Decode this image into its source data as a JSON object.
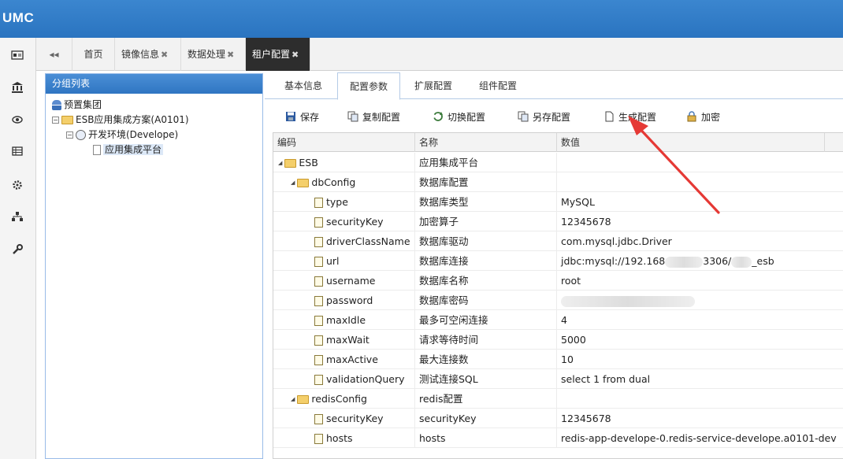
{
  "app": {
    "title": "UMC"
  },
  "sidebar_icons": [
    "id-card-icon",
    "bank-icon",
    "eye-icon",
    "list-icon",
    "gear-icon",
    "sitemap-icon",
    "wrench-icon"
  ],
  "tabs": {
    "nav_glyph": "◂◂",
    "items": [
      {
        "label": "首页",
        "closable": false
      },
      {
        "label": "镜像信息",
        "closable": true
      },
      {
        "label": "数据处理",
        "closable": true
      },
      {
        "label": "租户配置",
        "closable": true,
        "active": true
      }
    ],
    "close_glyph": "✖"
  },
  "tree_panel": {
    "title": "分组列表",
    "nodes": [
      {
        "label": "预置集团"
      },
      {
        "label": "ESB应用集成方案(A0101)"
      },
      {
        "label": "开发环境(Develope)"
      },
      {
        "label": "应用集成平台",
        "selected": true
      }
    ]
  },
  "content_tabs": [
    {
      "label": "基本信息"
    },
    {
      "label": "配置参数",
      "active": true
    },
    {
      "label": "扩展配置"
    },
    {
      "label": "组件配置"
    }
  ],
  "toolbar": {
    "save": "保存",
    "copy": "复制配置",
    "switch": "切换配置",
    "save_as": "另存配置",
    "generate": "生成配置",
    "encrypt": "加密"
  },
  "grid": {
    "columns": [
      "编码",
      "名称",
      "数值"
    ],
    "rows": [
      {
        "code": "ESB",
        "name": "应用集成平台",
        "value": "",
        "level": 0,
        "kind": "folder"
      },
      {
        "code": "dbConfig",
        "name": "数据库配置",
        "value": "",
        "level": 1,
        "kind": "folder"
      },
      {
        "code": "type",
        "name": "数据库类型",
        "value": "MySQL",
        "level": 2,
        "kind": "leaf"
      },
      {
        "code": "securityKey",
        "name": "加密算子",
        "value": "12345678",
        "level": 2,
        "kind": "leaf"
      },
      {
        "code": "driverClassName",
        "name": "数据库驱动",
        "value": "com.mysql.jdbc.Driver",
        "level": 2,
        "kind": "leaf"
      },
      {
        "code": "url",
        "name": "数据库连接",
        "value_parts": [
          "jdbc:mysql://192.168",
          "3306/",
          "_esb"
        ],
        "level": 2,
        "kind": "leaf"
      },
      {
        "code": "username",
        "name": "数据库名称",
        "value": "root",
        "level": 2,
        "kind": "leaf"
      },
      {
        "code": "password",
        "name": "数据库密码",
        "value": "",
        "level": 2,
        "kind": "leaf",
        "redacted": true
      },
      {
        "code": "maxIdle",
        "name": "最多可空闲连接",
        "value": "4",
        "level": 2,
        "kind": "leaf"
      },
      {
        "code": "maxWait",
        "name": "请求等待时间",
        "value": "5000",
        "level": 2,
        "kind": "leaf"
      },
      {
        "code": "maxActive",
        "name": "最大连接数",
        "value": "10",
        "level": 2,
        "kind": "leaf"
      },
      {
        "code": "validationQuery",
        "name": "测试连接SQL",
        "value": "select 1 from dual",
        "level": 2,
        "kind": "leaf"
      },
      {
        "code": "redisConfig",
        "name": "redis配置",
        "value": "",
        "level": 1,
        "kind": "folder"
      },
      {
        "code": "securityKey",
        "name": "securityKey",
        "value": "12345678",
        "level": 2,
        "kind": "leaf"
      },
      {
        "code": "hosts",
        "name": "hosts",
        "value": "redis-app-develope-0.redis-service-develope.a0101-dev",
        "level": 2,
        "kind": "leaf"
      }
    ]
  },
  "annotation_color": "#e53935"
}
